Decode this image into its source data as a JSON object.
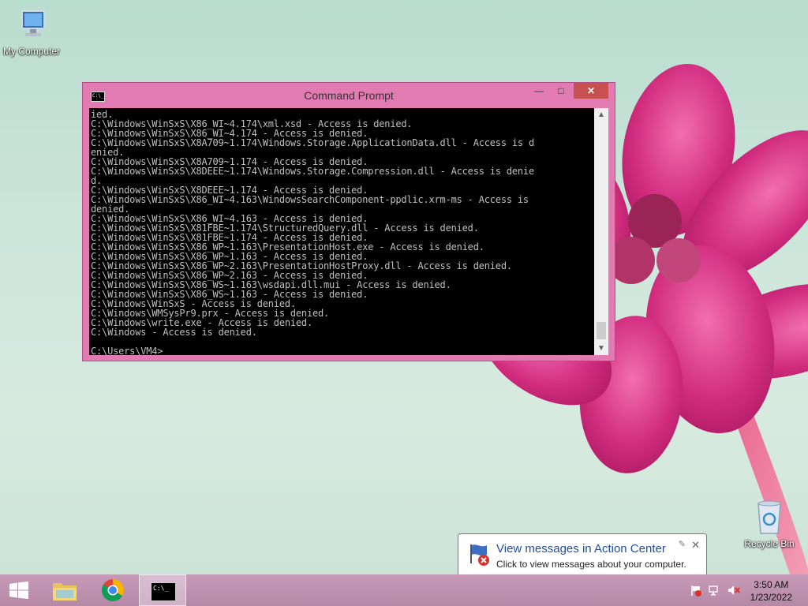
{
  "desktop": {
    "my_computer_label": "My Computer",
    "recycle_bin_label": "Recycle Bin"
  },
  "window": {
    "title": "Command Prompt",
    "min_glyph": "—",
    "max_glyph": "□",
    "close_glyph": "✕",
    "icon_text": "C:\\_",
    "console_lines": "ied.\nC:\\Windows\\WinSxS\\X86_WI~4.174\\xml.xsd - Access is denied.\nC:\\Windows\\WinSxS\\X86_WI~4.174 - Access is denied.\nC:\\Windows\\WinSxS\\X8A709~1.174\\Windows.Storage.ApplicationData.dll - Access is d\nenied.\nC:\\Windows\\WinSxS\\X8A709~1.174 - Access is denied.\nC:\\Windows\\WinSxS\\X8DEEE~1.174\\Windows.Storage.Compression.dll - Access is denie\nd.\nC:\\Windows\\WinSxS\\X8DEEE~1.174 - Access is denied.\nC:\\Windows\\WinSxS\\X86_WI~4.163\\WindowsSearchComponent-ppdlic.xrm-ms - Access is\ndenied.\nC:\\Windows\\WinSxS\\X86_WI~4.163 - Access is denied.\nC:\\Windows\\WinSxS\\X81FBE~1.174\\StructuredQuery.dll - Access is denied.\nC:\\Windows\\WinSxS\\X81FBE~1.174 - Access is denied.\nC:\\Windows\\WinSxS\\X86_WP~1.163\\PresentationHost.exe - Access is denied.\nC:\\Windows\\WinSxS\\X86_WP~1.163 - Access is denied.\nC:\\Windows\\WinSxS\\X86_WP~2.163\\PresentationHostProxy.dll - Access is denied.\nC:\\Windows\\WinSxS\\X86_WP~2.163 - Access is denied.\nC:\\Windows\\WinSxS\\X86_WS~1.163\\wsdapi.dll.mui - Access is denied.\nC:\\Windows\\WinSxS\\X86_WS~1.163 - Access is denied.\nC:\\Windows\\WinSxS - Access is denied.\nC:\\Windows\\WMSysPr9.prx - Access is denied.\nC:\\Windows\\write.exe - Access is denied.\nC:\\Windows - Access is denied.\n\nC:\\Users\\VM4>_",
    "scroll_up": "▲",
    "scroll_down": "▼"
  },
  "notification": {
    "title": "View messages in Action Center",
    "text": "Click to view messages about your computer.",
    "close_glyph": "✕",
    "pin_glyph": "✎"
  },
  "taskbar": {
    "clock_time": "3:50 AM",
    "clock_date": "1/23/2022",
    "console_button_text": "C:\\_"
  },
  "colors": {
    "window_frame": "#e17bb1",
    "taskbar": "#c79bb8",
    "close_button": "#c75050"
  }
}
